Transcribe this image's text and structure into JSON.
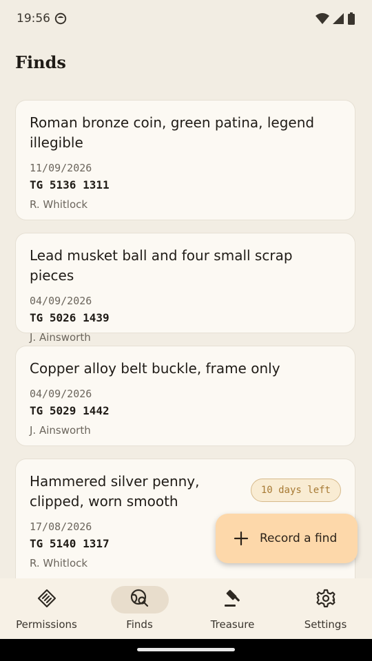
{
  "status_bar": {
    "time": "19:56",
    "icons": [
      "face-icon",
      "wifi-icon",
      "signal-icon",
      "battery-icon"
    ]
  },
  "page": {
    "title": "Finds"
  },
  "finds": [
    {
      "title": "Roman bronze coin, green patina, legend illegible",
      "date": "11/09/2026",
      "grid_ref": "TG 5136 1311",
      "recorder": "R. Whitlock",
      "badge": ""
    },
    {
      "title": "Lead musket ball and four small scrap pieces",
      "date": "04/09/2026",
      "grid_ref": "TG 5026 1439",
      "recorder": "J. Ainsworth",
      "badge": ""
    },
    {
      "title": "Copper alloy belt buckle, frame only",
      "date": "04/09/2026",
      "grid_ref": "TG 5029 1442",
      "recorder": "J. Ainsworth",
      "badge": ""
    },
    {
      "title": "Hammered silver penny, clipped, worn smooth",
      "date": "17/08/2026",
      "grid_ref": "TG 5140 1317",
      "recorder": "R. Whitlock",
      "badge": "10 days left"
    }
  ],
  "fab": {
    "label": "Record a find",
    "icon": "plus-icon"
  },
  "nav": {
    "items": [
      {
        "label": "Permissions",
        "icon": "handshake-icon"
      },
      {
        "label": "Finds",
        "icon": "globe-search-icon",
        "active": true
      },
      {
        "label": "Treasure",
        "icon": "gavel-icon"
      },
      {
        "label": "Settings",
        "icon": "gear-icon"
      }
    ]
  },
  "colors": {
    "background": "#f2ede3",
    "card": "#fcf9f3",
    "fab": "#fdd8aa",
    "badge_text": "#a77a34",
    "nav_active": "#e8ddcc"
  }
}
